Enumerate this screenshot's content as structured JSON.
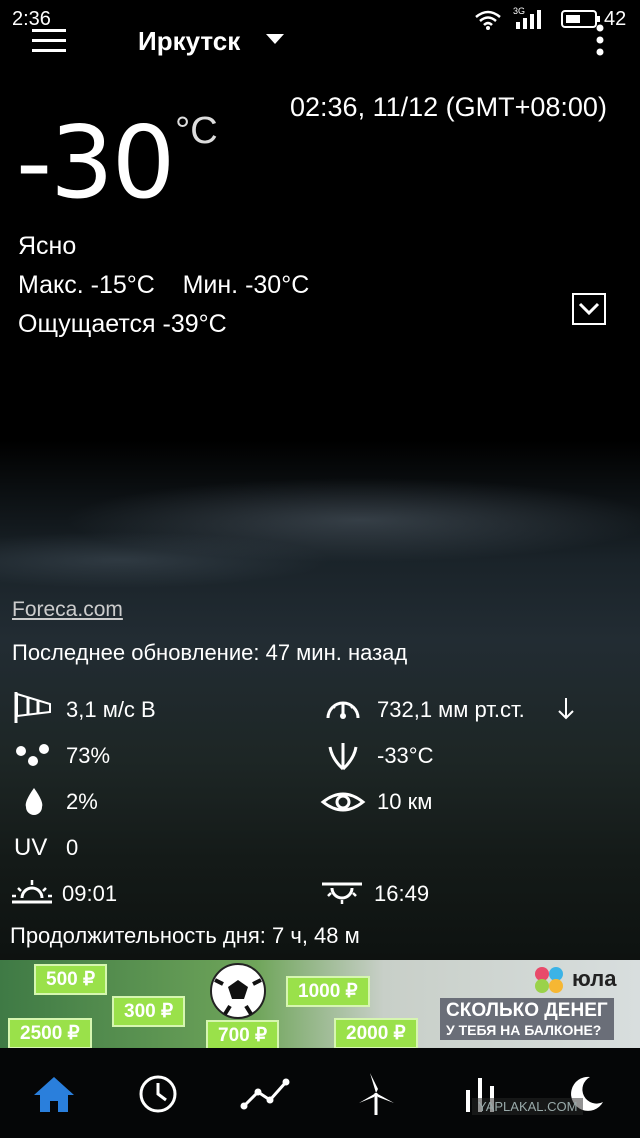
{
  "status_bar": {
    "time": "2:36",
    "network": "3G",
    "battery": "42"
  },
  "header": {
    "city": "Иркутск"
  },
  "current": {
    "datetime": "02:36, 11/12 (GMT+08:00)",
    "temperature": "-30",
    "unit": "°C",
    "condition": "Ясно",
    "max_min": "Макс. -15°C    Мин. -30°C",
    "feels_like": "Ощущается -39°C"
  },
  "details": {
    "source": "Foreca.com",
    "last_update": "Последнее обновление: 47 мин. назад",
    "wind": "3,1 м/с В",
    "pressure": "732,1 мм рт.ст.",
    "humidity": "73%",
    "dew_point": "-33°C",
    "precipitation": "2%",
    "visibility": "10 км",
    "uv_label": "UV",
    "uv": "0",
    "sunrise": "09:01",
    "sunset": "16:49",
    "day_length": "Продолжительность дня: 7 ч, 48 м"
  },
  "ad": {
    "brand": "юла",
    "line1": "СКОЛЬКО ДЕНЕГ",
    "line2": "У ТЕБЯ НА БАЛКОНЕ?",
    "prices": [
      "500 ₽",
      "300 ₽",
      "1000 ₽",
      "2500 ₽",
      "700 ₽",
      "2000 ₽"
    ]
  },
  "watermark": "YAPLAKAL.COM",
  "colors": {
    "accent": "#2a7fdc",
    "pill": "#9ae14a"
  }
}
